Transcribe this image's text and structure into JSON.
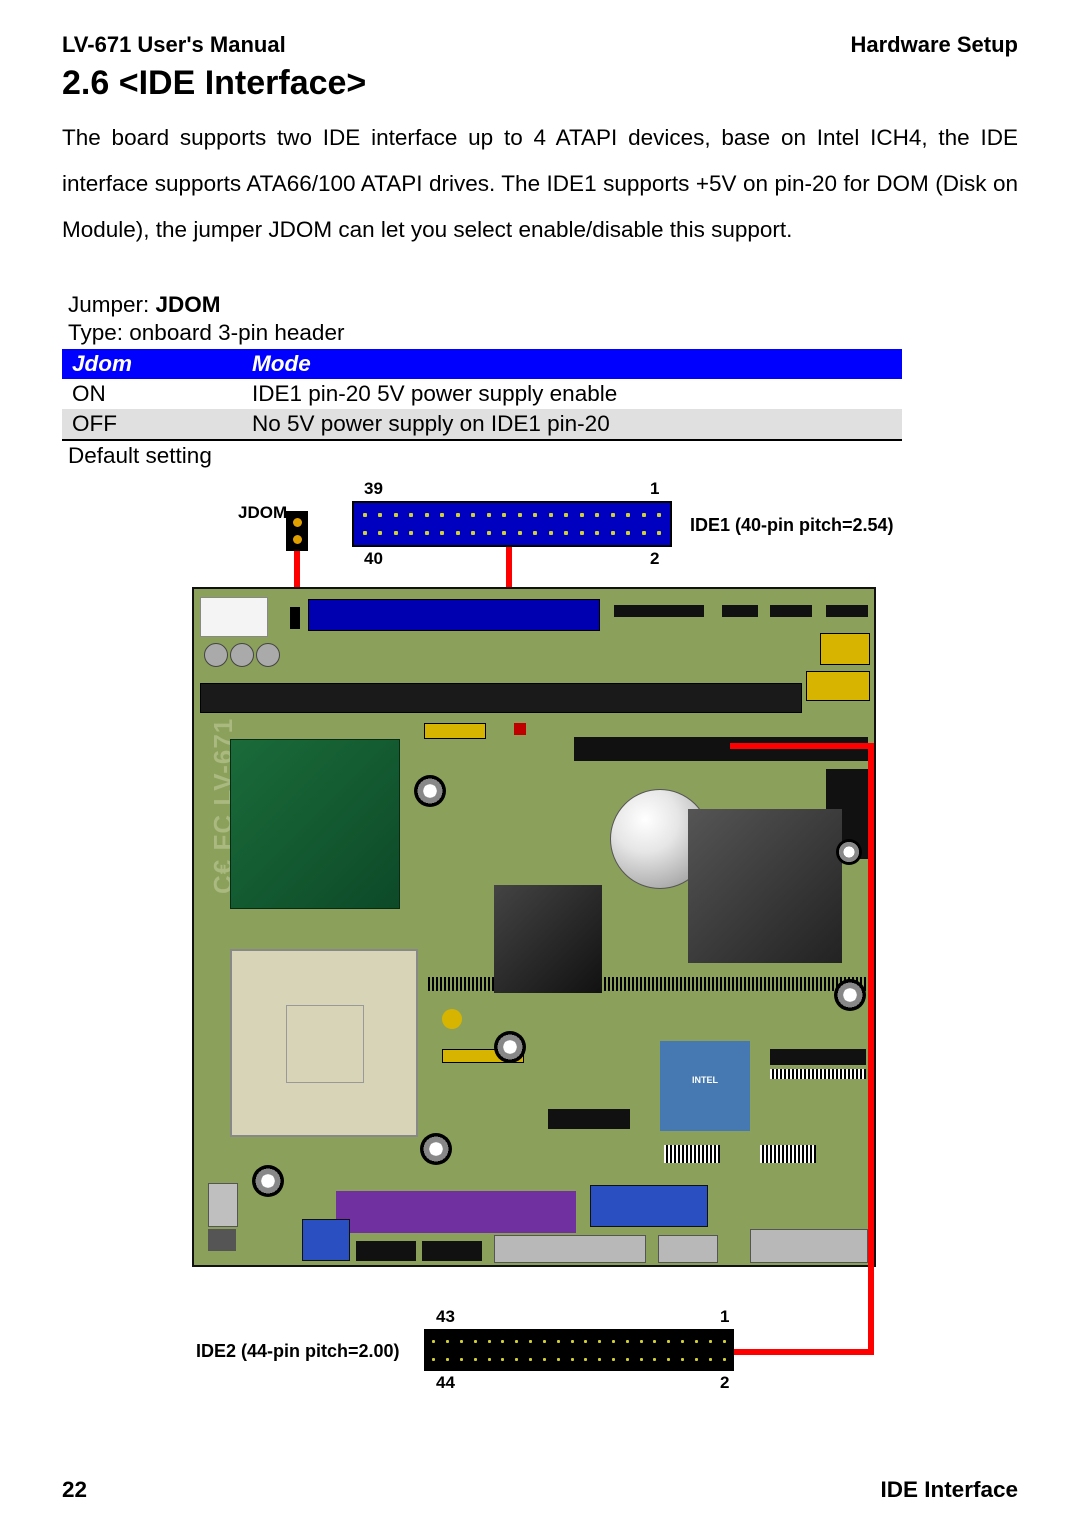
{
  "header": {
    "left": "LV-671 User's Manual",
    "right": "Hardware Setup"
  },
  "section": {
    "title": "2.6 <IDE Interface>"
  },
  "body": "The board supports two IDE interface up to 4 ATAPI devices, base on Intel ICH4, the IDE interface supports ATA66/100 ATAPI drives. The IDE1 supports +5V on pin-20 for DOM (Disk on Module), the jumper JDOM can let you select enable/disable this support.",
  "jumper": {
    "label_prefix": "Jumper: ",
    "name": "JDOM",
    "type": "Type: onboard 3-pin header",
    "table": {
      "headers": [
        "Jdom",
        "Mode"
      ],
      "rows": [
        {
          "jdom": "ON",
          "mode": "IDE1 pin-20 5V power supply enable"
        },
        {
          "jdom": "OFF",
          "mode": "No 5V power supply on IDE1 pin-20"
        }
      ]
    },
    "default": "Default setting"
  },
  "diagram": {
    "jdom_label": "JDOM",
    "ide1": {
      "label": "IDE1 (40-pin pitch=2.54)",
      "pins": {
        "tl": "39",
        "tr": "1",
        "bl": "40",
        "br": "2"
      }
    },
    "ide2": {
      "label": "IDE2 (44-pin pitch=2.00)",
      "pins": {
        "tl": "43",
        "tr": "1",
        "bl": "44",
        "br": "2"
      }
    },
    "board_text": "C€ FC  LV-671",
    "chip_intel_small": "INTEL"
  },
  "footer": {
    "page": "22",
    "title": "IDE  Interface"
  }
}
